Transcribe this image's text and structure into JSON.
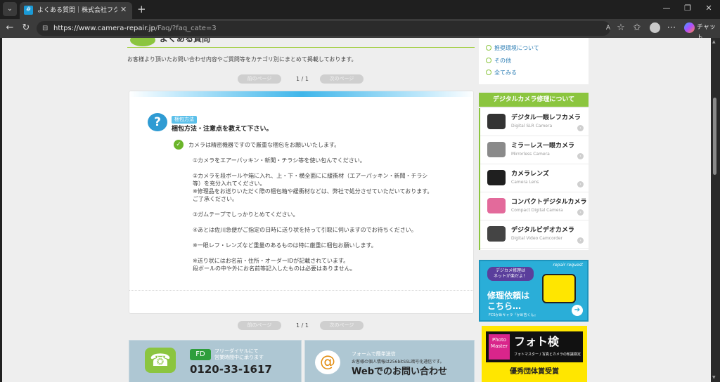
{
  "browser": {
    "tab_title": "よくある質問｜株式会社フクイカメラサ",
    "tab_close": "✕",
    "new_tab": "+",
    "url_host": "https://www.camera-repair.jp",
    "url_path": "/Faq/?faq_cate=3",
    "chat_label": "チャット",
    "window_controls": [
      "—",
      "❐",
      "✕"
    ]
  },
  "page": {
    "title": "よくある質問",
    "intro": "お客様より頂いたお問い合わせ内容やご質問等をカテゴリ別にまとめて掲載しております。",
    "pager": {
      "prev": "前のページ",
      "page": "1 / 1",
      "next": "次のページ"
    },
    "pager_bottom": {
      "prev": "前のページ",
      "page": "1 / 1",
      "next": "次のページ"
    }
  },
  "faq": {
    "category": "梱包方法",
    "question": "梱包方法・注意点を教えて下さい。",
    "answer_lines": [
      "カメラは精密機器ですので厳重な梱包をお願いいたします。",
      "",
      "①カメラをエアーパッキン・新聞・チラシ等を使い包んでください。",
      "",
      "②カメラを段ボールや箱に入れ、上・下・横全面にに緩衝材（エアーパッキン・新聞・チラシ",
      "等）を充分入れてください。",
      "※修理品をお送りいただく際の梱包箱や緩衝材などは、弊社で処分させていただいております。",
      "ご了承ください。",
      "",
      "③ガムテープでしっかりとめてください。",
      "",
      "④あとは佐川急便がご指定の日時に送り状を持って引取に伺いますのでお待ちください。",
      "",
      "※一眼レフ・レンズなど重量のあるものは特に厳重に梱包お願いします。",
      "",
      "※送り状にはお名前・住所・オーダーIDが記載されています。",
      "段ボールの中や外にお名前等記入したものは必要はありません。"
    ]
  },
  "contact": {
    "freedial_logo": "FD",
    "freedial_text": [
      "フリーダイヤルにて",
      "営業時間中に承ります"
    ],
    "phone": "0120-33-1617",
    "web_sub": "フォームで簡単送信",
    "web_note": "お客様の個人情報は256bitSSL暗号化通信です。",
    "web_title": "Webでのお問い合わせ"
  },
  "sidebar": {
    "links": [
      "推奨環境について",
      "その他",
      "全てみる"
    ],
    "section_title": "デジタルカメラ修理について",
    "cameras": [
      {
        "name": "デジタル一眼レフカメラ",
        "sub": "Digital SLR Camera",
        "color": "#333333"
      },
      {
        "name": "ミラーレス一眼カメラ",
        "sub": "Mirrorless Camera",
        "color": "#8a8a8a"
      },
      {
        "name": "カメラレンズ",
        "sub": "Camera Lens",
        "color": "#1f1f1f"
      },
      {
        "name": "コンパクトデジタルカメラ",
        "sub": "Compact Digital Camera",
        "color": "#e36a9b"
      },
      {
        "name": "デジタルビデオカメラ",
        "sub": "Digital Video Camcorder",
        "color": "#444444"
      }
    ],
    "repair_banner": {
      "top": "repair request",
      "bubble": "デジカメ修理は\nネットが楽だよ！",
      "main": "修理依頼は\nこちら…",
      "small": "FCSかめキャラ『かめ吉くん』",
      "go": "➔"
    },
    "photo_banner": {
      "logo": "Photo\nMaster",
      "title": "フォト検",
      "sub": "フォトマスター / 写真とカメラの知識検定",
      "award": "優秀団体賞受賞"
    }
  }
}
